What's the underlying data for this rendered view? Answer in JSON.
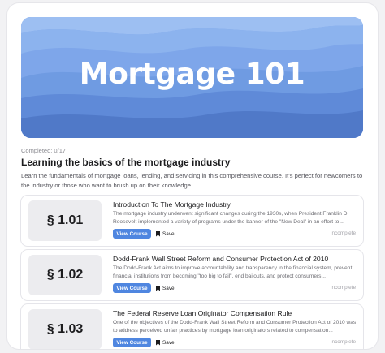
{
  "hero": {
    "title": "Mortgage 101"
  },
  "course": {
    "completed": "Completed: 0/17",
    "title": "Learning the basics of the mortgage industry",
    "description": "Learn the fundamentals of mortgage loans, lending, and servicing in this comprehensive course. It's perfect for newcomers to the industry or those who want to brush up on their knowledge."
  },
  "lessons": [
    {
      "number": "§ 1.01",
      "title": "Introduction To The Mortgage Industry",
      "description": "The mortgage industry underwent significant changes during the 1930s, when President Franklin D. Roosevelt implemented a variety of programs under the banner of the \"New Deal\" in an effort to...",
      "view_label": "View Course",
      "save_label": "Save",
      "status": "Incomplete"
    },
    {
      "number": "§ 1.02",
      "title": "Dodd-Frank Wall Street Reform and Consumer Protection Act of 2010",
      "description": "The Dodd-Frank Act aims to improve accountability and transparency in the financial system, prevent financial institutions from becoming \"too big to fail\", end bailouts, and protect consumers...",
      "view_label": "View Course",
      "save_label": "Save",
      "status": "Incomplete"
    },
    {
      "number": "§ 1.03",
      "title": "The Federal Reserve Loan Originator Compensation Rule",
      "description": "One of the objectives of the Dodd-Frank Wall Street Reform and Consumer Protection Act of 2010 was to address perceived unfair practices by mortgage loan originators related to compensation...",
      "view_label": "View Course",
      "save_label": "Save",
      "status": "Incomplete"
    }
  ],
  "colors": {
    "accent": "#4f86e0",
    "hero_wave_light": "#8fb4ee",
    "hero_wave_dark": "#4f7ccc"
  },
  "icons": {
    "save": "bookmark-icon"
  }
}
